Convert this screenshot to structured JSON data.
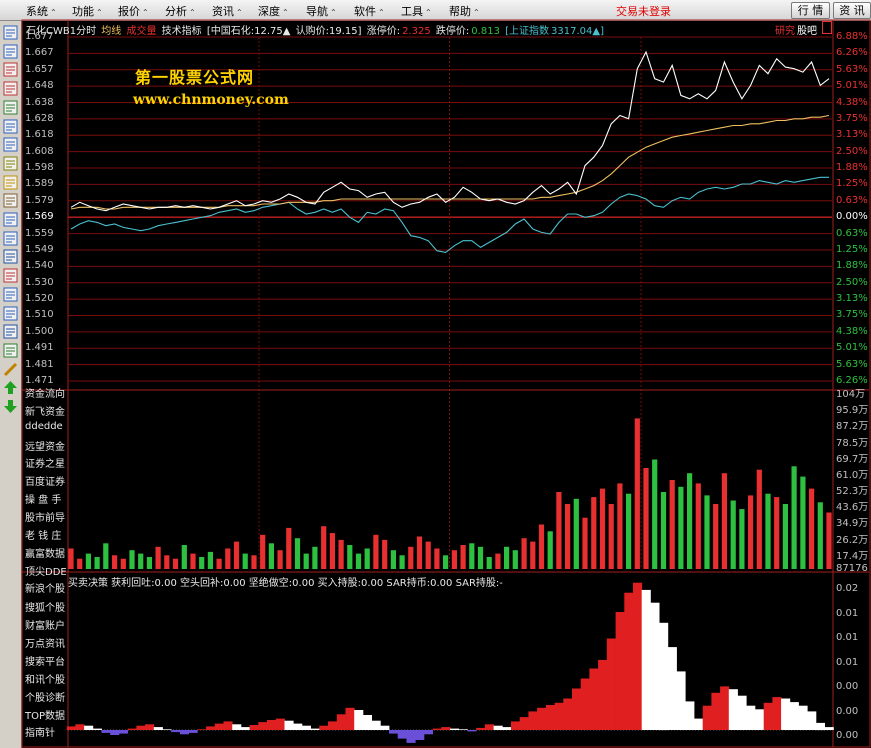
{
  "menu": [
    {
      "label": "系统"
    },
    {
      "label": "功能"
    },
    {
      "label": "报价"
    },
    {
      "label": "分析"
    },
    {
      "label": "资讯"
    },
    {
      "label": "深度"
    },
    {
      "label": "导航"
    },
    {
      "label": "软件"
    },
    {
      "label": "工具"
    },
    {
      "label": "帮助"
    }
  ],
  "menu_chevron": "⌃",
  "login_status": "交易未登录",
  "buttons": {
    "trade": "行 情",
    "info": "资 讯"
  },
  "chart_header": {
    "title": "石化CWB1分时",
    "avg_line": "均线",
    "volume": "成交量",
    "indicator": "技术指标",
    "underlying": "[中国石化:12.75▲",
    "subscription_price": "认购价:19.15]",
    "limit_up_label": "涨停价:",
    "limit_up_value": "2.325",
    "limit_down_label": "跌停价:",
    "limit_down_value": "0.813",
    "index_label": "[上证指数",
    "index_value": "3317.04▲]",
    "research": "研究",
    "forum": "股吧"
  },
  "watermark": {
    "line1": "第一股票公式网",
    "line2": "www.chnmoney.com"
  },
  "price_axis": [
    "1.677",
    "1.667",
    "1.657",
    "1.648",
    "1.638",
    "1.628",
    "1.618",
    "1.608",
    "1.598",
    "1.589",
    "1.579",
    "1.569",
    "1.559",
    "1.549",
    "1.540",
    "1.530",
    "1.520",
    "1.510",
    "1.500",
    "1.491",
    "1.481",
    "1.471"
  ],
  "pct_axis": [
    "6.88%",
    "6.26%",
    "5.63%",
    "5.01%",
    "4.38%",
    "3.75%",
    "3.13%",
    "2.50%",
    "1.88%",
    "1.25%",
    "0.63%",
    "0.00%",
    "0.63%",
    "1.25%",
    "1.88%",
    "2.50%",
    "3.13%",
    "3.75%",
    "4.38%",
    "5.01%",
    "5.63%",
    "6.26%"
  ],
  "volume_axis": [
    "104万",
    "95.9万",
    "87.2万",
    "78.5万",
    "69.7万",
    "61.0万",
    "52.3万",
    "43.6万",
    "34.9万",
    "26.2万",
    "17.4万",
    "87176"
  ],
  "left_links": [
    "资金流向",
    "新飞资金",
    "ddedde",
    "远望资金",
    "证券之星",
    "百度证券",
    "操 盘 手",
    "股市前导",
    "老 钱 庄",
    "赢富数据",
    "顶尖DDE",
    "新浪个股",
    "搜狐个股",
    "财富账户",
    "万点资讯",
    "搜索平台",
    "和讯个股",
    "个股诊断",
    "TOP数据",
    "指南针"
  ],
  "indicator_header": "买卖决策  获利回吐:0.00  空头回补:0.00  坚绝做空:0.00  买入持股:0.00  SAR持币:0.00  SAR持股:-",
  "indicator_axis": [
    "0.02",
    "0.01",
    "0.01",
    "0.01",
    "0.00",
    "0.00",
    "0.00"
  ],
  "toolbar_icons": [
    "grid-icon",
    "table-icon",
    "line-chart-icon",
    "candle-icon",
    "bars-icon",
    "list-icon",
    "report-icon",
    "document-icon",
    "mail-icon",
    "people-icon",
    "timeline-icon",
    "search-icon",
    "f10-icon",
    "wave-icon",
    "compare-icon",
    "monitor-icon",
    "percent-icon",
    "export-icon",
    "pencil-icon",
    "arrow-up-icon",
    "arrow-down-icon"
  ],
  "colors": {
    "price_line": "#ffffff",
    "avg_line": "#f0c060",
    "index_line": "#4ac0d0",
    "up": "#e83030",
    "down": "#2ec040",
    "watermark": "#ffd200"
  },
  "chart_data": {
    "type": "line",
    "ylim": [
      1.471,
      1.677
    ],
    "base_price": 1.569,
    "price": [
      1.575,
      1.578,
      1.576,
      1.574,
      1.573,
      1.575,
      1.577,
      1.576,
      1.575,
      1.574,
      1.575,
      1.575,
      1.576,
      1.575,
      1.576,
      1.575,
      1.574,
      1.575,
      1.577,
      1.579,
      1.576,
      1.577,
      1.579,
      1.578,
      1.58,
      1.583,
      1.581,
      1.578,
      1.577,
      1.584,
      1.587,
      1.59,
      1.586,
      1.585,
      1.581,
      1.583,
      1.584,
      1.578,
      1.575,
      1.577,
      1.578,
      1.581,
      1.583,
      1.578,
      1.581,
      1.587,
      1.584,
      1.58,
      1.579,
      1.58,
      1.578,
      1.577,
      1.579,
      1.584,
      1.588,
      1.583,
      1.586,
      1.59,
      1.583,
      1.6,
      1.605,
      1.612,
      1.625,
      1.63,
      1.628,
      1.658,
      1.668,
      1.652,
      1.65,
      1.66,
      1.642,
      1.64,
      1.643,
      1.64,
      1.645,
      1.662,
      1.65,
      1.64,
      1.648,
      1.66,
      1.655,
      1.664,
      1.659,
      1.658,
      1.656,
      1.662,
      1.648,
      1.652
    ],
    "avg": [
      1.574,
      1.575,
      1.575,
      1.575,
      1.574,
      1.574,
      1.575,
      1.575,
      1.575,
      1.575,
      1.575,
      1.575,
      1.575,
      1.575,
      1.575,
      1.575,
      1.575,
      1.575,
      1.576,
      1.576,
      1.576,
      1.576,
      1.577,
      1.577,
      1.577,
      1.578,
      1.578,
      1.578,
      1.578,
      1.579,
      1.579,
      1.58,
      1.58,
      1.58,
      1.58,
      1.58,
      1.58,
      1.58,
      1.58,
      1.58,
      1.58,
      1.58,
      1.58,
      1.58,
      1.58,
      1.58,
      1.58,
      1.58,
      1.58,
      1.58,
      1.58,
      1.58,
      1.58,
      1.58,
      1.581,
      1.581,
      1.582,
      1.583,
      1.584,
      1.586,
      1.588,
      1.591,
      1.595,
      1.6,
      1.605,
      1.608,
      1.611,
      1.613,
      1.615,
      1.617,
      1.618,
      1.619,
      1.62,
      1.621,
      1.622,
      1.623,
      1.624,
      1.624,
      1.625,
      1.625,
      1.626,
      1.627,
      1.627,
      1.628,
      1.628,
      1.629,
      1.629,
      1.63
    ],
    "index": [
      1.562,
      1.565,
      1.567,
      1.566,
      1.564,
      1.565,
      1.563,
      1.562,
      1.561,
      1.562,
      1.564,
      1.565,
      1.566,
      1.567,
      1.568,
      1.569,
      1.57,
      1.572,
      1.573,
      1.574,
      1.572,
      1.573,
      1.575,
      1.576,
      1.577,
      1.578,
      1.574,
      1.571,
      1.572,
      1.574,
      1.572,
      1.574,
      1.569,
      1.566,
      1.572,
      1.571,
      1.574,
      1.573,
      1.566,
      1.558,
      1.557,
      1.555,
      1.549,
      1.548,
      1.552,
      1.555,
      1.555,
      1.551,
      1.554,
      1.557,
      1.56,
      1.565,
      1.568,
      1.562,
      1.56,
      1.559,
      1.566,
      1.571,
      1.571,
      1.569,
      1.57,
      1.572,
      1.577,
      1.581,
      1.583,
      1.582,
      1.58,
      1.576,
      1.575,
      1.579,
      1.581,
      1.58,
      1.584,
      1.586,
      1.587,
      1.586,
      1.587,
      1.589,
      1.589,
      1.591,
      1.59,
      1.589,
      1.591,
      1.59,
      1.591,
      1.592,
      1.593,
      1.593
    ],
    "volume_max": 1040000,
    "volume": [
      120000,
      60000,
      90000,
      70000,
      150000,
      80000,
      60000,
      110000,
      90000,
      70000,
      130000,
      80000,
      60000,
      140000,
      90000,
      70000,
      100000,
      60000,
      120000,
      160000,
      90000,
      80000,
      200000,
      150000,
      110000,
      240000,
      180000,
      90000,
      130000,
      250000,
      210000,
      170000,
      140000,
      90000,
      120000,
      200000,
      170000,
      110000,
      80000,
      130000,
      190000,
      160000,
      120000,
      80000,
      110000,
      140000,
      150000,
      130000,
      70000,
      90000,
      130000,
      110000,
      180000,
      160000,
      260000,
      220000,
      450000,
      380000,
      410000,
      300000,
      420000,
      470000,
      380000,
      500000,
      440000,
      880000,
      590000,
      640000,
      450000,
      520000,
      480000,
      560000,
      500000,
      430000,
      380000,
      560000,
      400000,
      350000,
      430000,
      580000,
      440000,
      420000,
      380000,
      600000,
      540000,
      470000,
      390000,
      330000
    ],
    "indicator_max": 0.02,
    "indicator": [
      0.0005,
      0.0008,
      0.0006,
      0.0002,
      -0.0004,
      -0.0007,
      -0.0005,
      0.0002,
      0.0006,
      0.0008,
      0.0004,
      0.0001,
      -0.0003,
      -0.0006,
      -0.0004,
      0.0001,
      0.0005,
      0.0009,
      0.0012,
      0.0008,
      0.0004,
      0.0007,
      0.0011,
      0.0014,
      0.0016,
      0.0013,
      0.0009,
      0.0006,
      0.0002,
      0.0006,
      0.0012,
      0.0022,
      0.0031,
      0.0028,
      0.0021,
      0.0013,
      0.0006,
      -0.0005,
      -0.0012,
      -0.0018,
      -0.0014,
      -0.0006,
      0.0002,
      0.0004,
      0.0002,
      0.0001,
      -0.0002,
      0.0003,
      0.0008,
      0.0006,
      0.0004,
      0.0012,
      0.0018,
      0.0026,
      0.0031,
      0.0035,
      0.0038,
      0.0044,
      0.0058,
      0.0072,
      0.0086,
      0.0098,
      0.0128,
      0.0165,
      0.0192,
      0.0206,
      0.0196,
      0.0178,
      0.015,
      0.0116,
      0.0082,
      0.004,
      0.0016,
      0.0034,
      0.0052,
      0.0061,
      0.0057,
      0.0048,
      0.0034,
      0.0029,
      0.0038,
      0.0046,
      0.0044,
      0.0039,
      0.0034,
      0.0026,
      0.001,
      0.0004
    ]
  }
}
